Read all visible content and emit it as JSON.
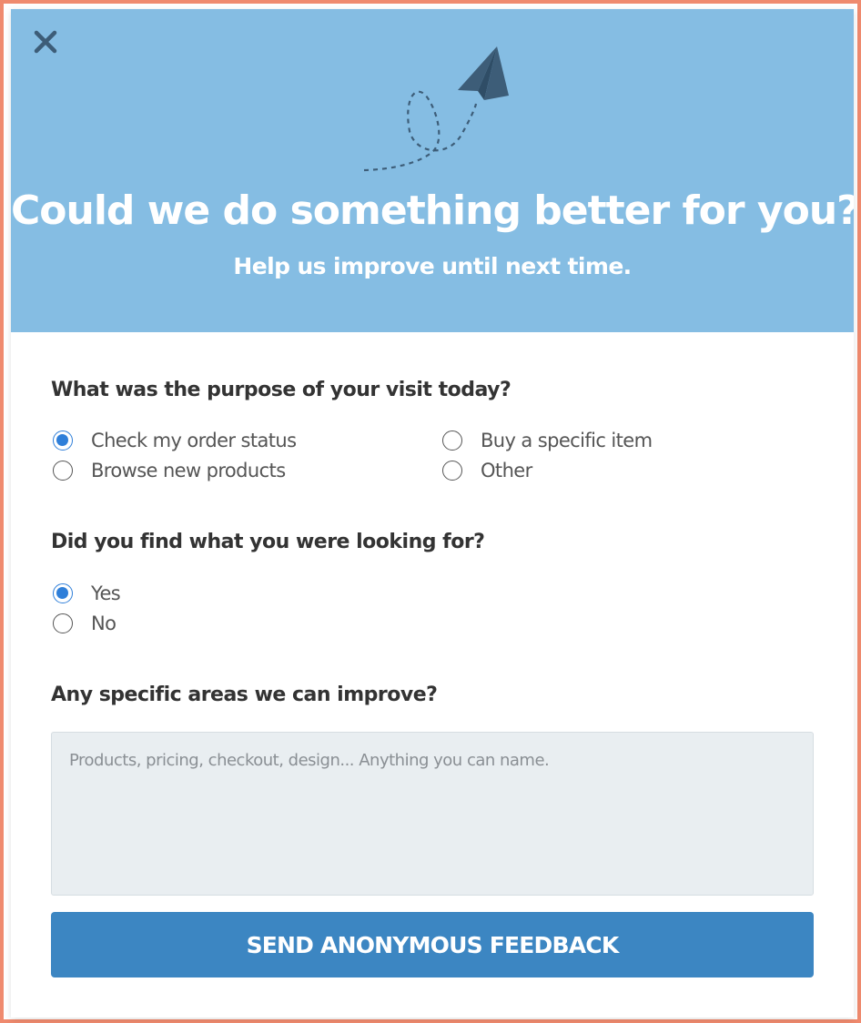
{
  "colors": {
    "frame_border": "#ef8a6e",
    "hero_background": "#85bde3",
    "accent_blue": "#2f7fd9",
    "button_background": "#3c86c2",
    "icon_dark": "#3d5d78"
  },
  "header": {
    "close_icon": "close-icon",
    "illustration_icon": "paper-plane-icon",
    "title": "Could we do something better for you?",
    "subtitle": "Help us improve until next time."
  },
  "questions": {
    "purpose": {
      "title": "What was the purpose of your visit today?",
      "options": [
        {
          "label": "Check my order status",
          "checked": true
        },
        {
          "label": "Buy a specific item",
          "checked": false
        },
        {
          "label": "Browse new products",
          "checked": false
        },
        {
          "label": "Other",
          "checked": false
        }
      ]
    },
    "found": {
      "title": "Did you find what you were looking for?",
      "options": [
        {
          "label": "Yes",
          "checked": true
        },
        {
          "label": "No",
          "checked": false
        }
      ]
    },
    "improve": {
      "title": "Any specific areas we can improve?",
      "value": "",
      "placeholder": "Products, pricing, checkout, design... Anything you can name."
    }
  },
  "submit": {
    "label": "SEND ANONYMOUS FEEDBACK"
  }
}
